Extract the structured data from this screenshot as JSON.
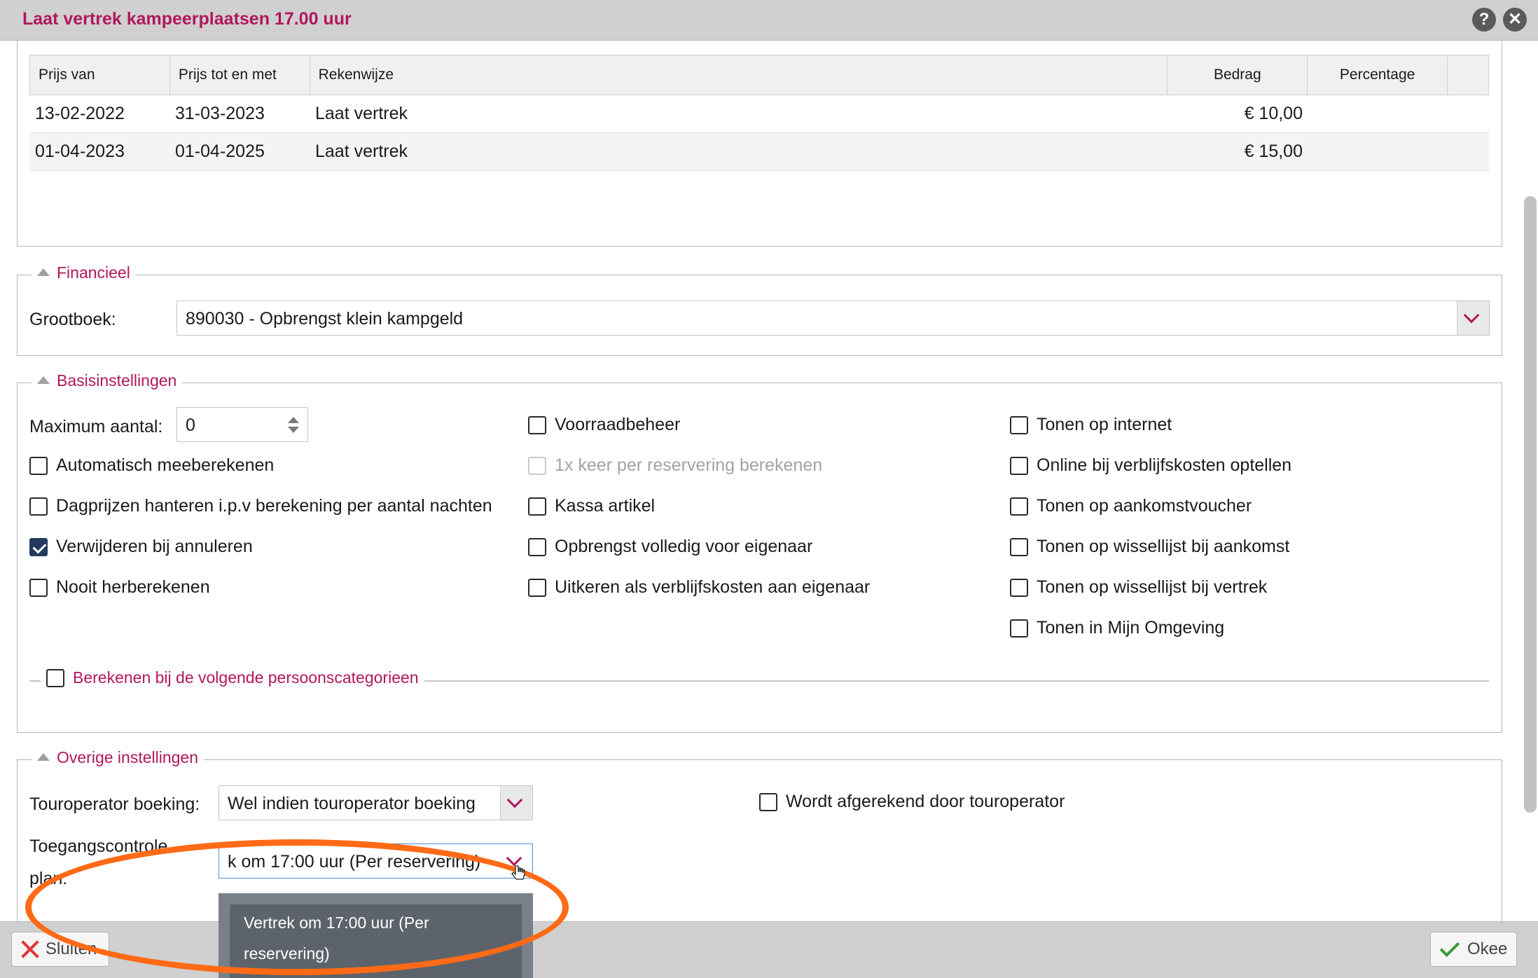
{
  "window": {
    "title": "Laat vertrek kampeerplaatsen 17.00 uur",
    "help_icon": "help-icon",
    "close_icon": "close-icon"
  },
  "price_table": {
    "columns": [
      "Prijs van",
      "Prijs tot en met",
      "Rekenwijze",
      "Bedrag",
      "Percentage"
    ],
    "rows": [
      {
        "from": "13-02-2022",
        "to": "31-03-2023",
        "method": "Laat vertrek",
        "amount": "€ 10,00",
        "percentage": ""
      },
      {
        "from": "01-04-2023",
        "to": "01-04-2025",
        "method": "Laat vertrek",
        "amount": "€ 15,00",
        "percentage": ""
      }
    ]
  },
  "financieel": {
    "legend": "Financieel",
    "grootboek_label": "Grootboek:",
    "grootboek_value": "890030 - Opbrengst klein kampgeld"
  },
  "basis": {
    "legend": "Basisinstellingen",
    "max_label": "Maximum aantal:",
    "max_value": "0",
    "col1": [
      {
        "label": "Automatisch meeberekenen",
        "checked": false
      },
      {
        "label": "Dagprijzen hanteren i.p.v berekening per aantal nachten",
        "checked": false
      },
      {
        "label": "Verwijderen bij annuleren",
        "checked": true
      },
      {
        "label": "Nooit herberekenen",
        "checked": false
      }
    ],
    "col2": [
      {
        "label": "Voorraadbeheer",
        "checked": false,
        "disabled": false
      },
      {
        "label": "1x keer per reservering berekenen",
        "checked": false,
        "disabled": true
      },
      {
        "label": "Kassa artikel",
        "checked": false,
        "disabled": false
      },
      {
        "label": "Opbrengst volledig voor eigenaar",
        "checked": false,
        "disabled": false
      },
      {
        "label": "Uitkeren als verblijfskosten aan eigenaar",
        "checked": false,
        "disabled": false
      }
    ],
    "col3": [
      {
        "label": "Tonen op internet",
        "checked": false
      },
      {
        "label": "Online bij verblijfskosten optellen",
        "checked": false
      },
      {
        "label": "Tonen op aankomstvoucher",
        "checked": false
      },
      {
        "label": "Tonen op wissellijst bij aankomst",
        "checked": false
      },
      {
        "label": "Tonen op wissellijst bij vertrek",
        "checked": false
      },
      {
        "label": "Tonen in Mijn Omgeving",
        "checked": false
      }
    ],
    "persons_legend": "Berekenen bij de volgende persoonscategorieen"
  },
  "overige": {
    "legend": "Overige instellingen",
    "touroperator_label": "Touroperator boeking:",
    "touroperator_value": "Wel indien touroperator boeking",
    "afgerekend_label": "Wordt afgerekend door touroperator",
    "toegang_label_line1": "Toegangscontrole",
    "toegang_label_line2": "plan:",
    "toegang_value": "k om 17:00 uur (Per reservering)"
  },
  "dropdown": {
    "option_line1": "Vertrek om 17:00 uur (Per",
    "option_line2": "reservering)"
  },
  "footer": {
    "close_label": "Sluiten",
    "ok_label": "Okee"
  },
  "colors": {
    "accent": "#b0175d",
    "highlight": "#ff6a16",
    "checked": "#233a5e"
  }
}
